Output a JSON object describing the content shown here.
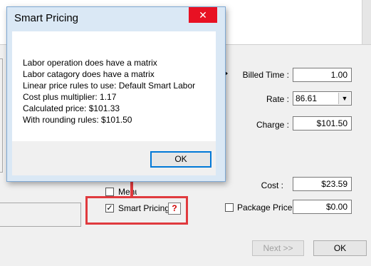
{
  "dialog": {
    "title": "Smart Pricing",
    "close_glyph": "✕",
    "message_lines": [
      "Labor operation does have a matrix",
      "Labor catagory does have a matrix",
      "Linear price rules to use: Default Smart Labor",
      "Cost plus multiplier: 1.17",
      "Calculated price: $101.33",
      "With rounding rules: $101.50"
    ],
    "ok_label": "OK"
  },
  "form": {
    "billed_time_label": "Billed Time :",
    "billed_time_value": "1.00",
    "rate_label": "Rate :",
    "rate_value": "86.61",
    "charge_label": "Charge :",
    "charge_value": "$101.50",
    "cost_label": "Cost :",
    "cost_value": "$23.59",
    "menu_label": "Menu",
    "smart_pricing_label": "Smart Pricing",
    "smart_pricing_checked": true,
    "help_glyph": "?",
    "package_price_label": "Package Price :",
    "package_price_value": "$0.00",
    "package_price_checked": false,
    "next_label": "Next >>",
    "ok_label": "OK"
  },
  "annotation": {
    "color": "#e03a3e"
  },
  "colors": {
    "dialog_title_bg": "#dae8f5",
    "close_bg": "#e81123",
    "accent": "#0078d7"
  }
}
